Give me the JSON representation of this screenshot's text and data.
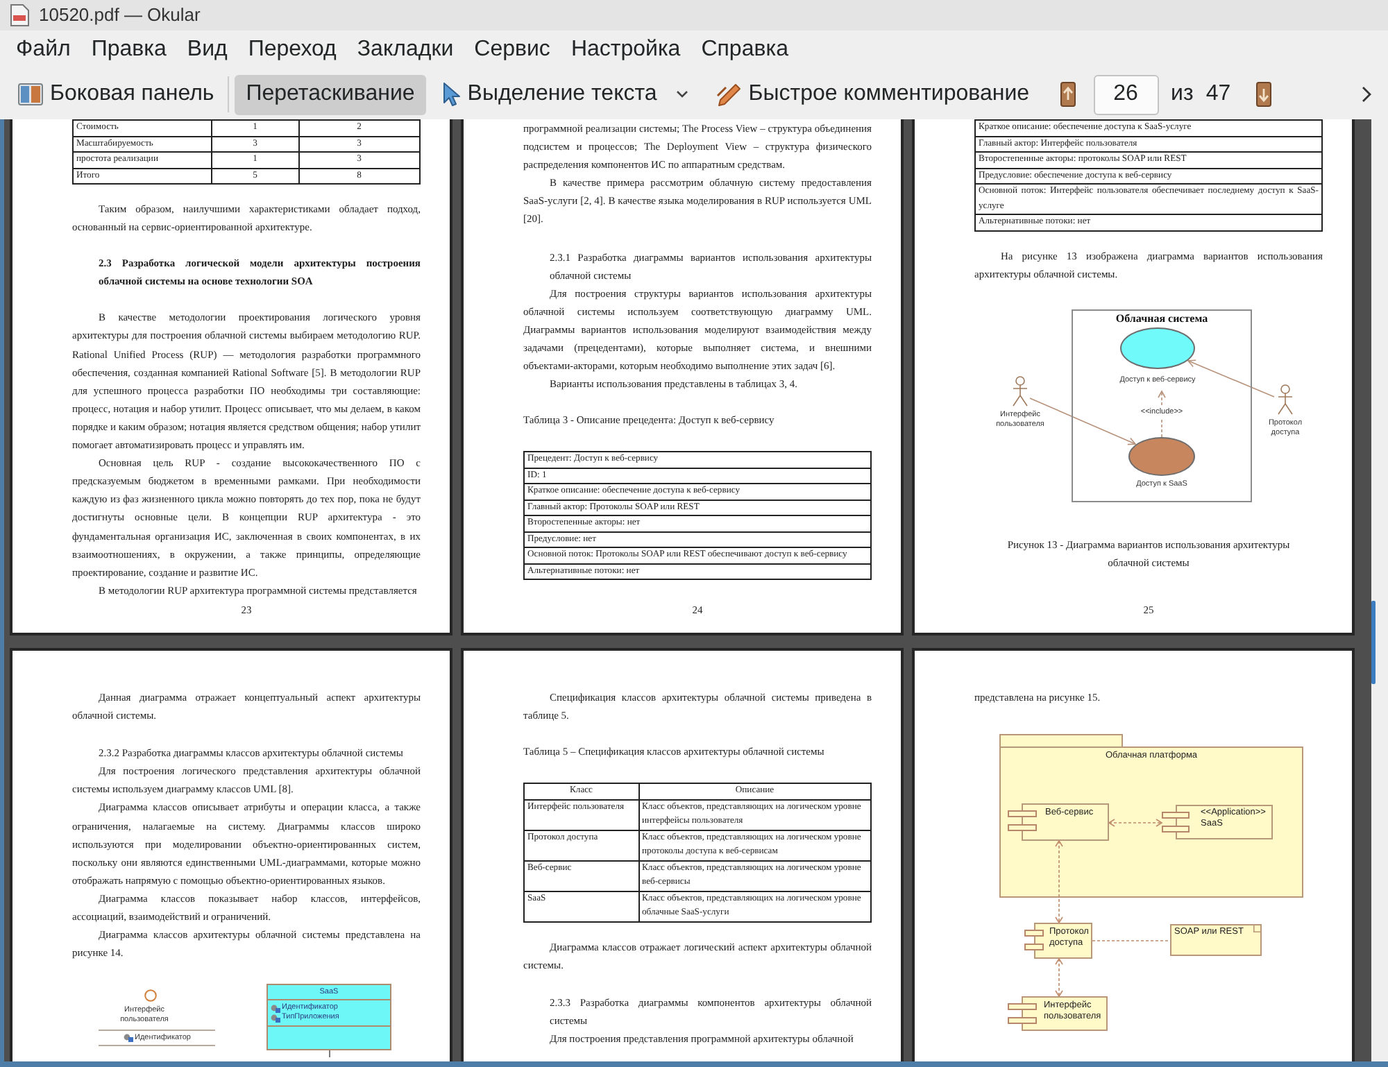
{
  "window": {
    "title": "10520.pdf — Okular"
  },
  "menu": [
    "Файл",
    "Правка",
    "Вид",
    "Переход",
    "Закладки",
    "Сервис",
    "Настройка",
    "Справка"
  ],
  "toolbar": {
    "sidebar_button": {
      "label": "Боковая панель"
    },
    "tools": [
      {
        "kind": "browse",
        "label": "Перетаскивание",
        "selected": true
      },
      {
        "kind": "text_select",
        "label": "Выделение текста",
        "selected": false
      },
      {
        "kind": "annotate",
        "label": "Быстрое комментирование",
        "selected": false
      }
    ],
    "page_field": {
      "value": "26"
    },
    "page_label": "из",
    "page_count": "47"
  },
  "pages": [
    {
      "number": "23",
      "blocks": [
        {
          "kind": "table",
          "rows": [
            [
              "Стоимость",
              "1",
              "2"
            ],
            [
              "Масштабируемость",
              "3",
              "3"
            ],
            [
              "простота реализации",
              "1",
              "3"
            ],
            [
              "Итого",
              "5",
              "8"
            ]
          ]
        },
        {
          "kind": "paragraph",
          "text": "Таким образом, наилучшими характеристиками обладает подход, основанный на сервис-ориентированной архитектуре."
        },
        {
          "kind": "heading",
          "text": "2.3 Разработка логической модели архитектуры построения облачной системы на основе технологии SOA"
        },
        {
          "kind": "paragraph",
          "text": "В качестве методологии проектирования логического уровня архитектуры для построения облачной системы выбираем методологию RUP. Rational Unified Process (RUP) — методология разработки программного обеспечения, созданная компанией Rational Software [5]. В методологии RUP для успешного процесса разработки ПО необходимы три составляющие: процесс, нотация и набор утилит. Процесс описывает, что мы делаем, в каком порядке и каким образом; нотация является средством общения; набор утилит помогает автоматизировать процесс и управлять им."
        },
        {
          "kind": "paragraph",
          "text": "Основная цель RUP - создание высококачественного ПО с предсказуемым бюджетом в временными рамками. При необходимости каждую из фаз жизненного цикла можно повторять до тех пор, пока не будут достигнуты основные цели. В концепции RUP архитектура - это фундаментальная организация ИС, заключенная в своих компонентах, в их взаимоотношениях, в окружении, а также принципы, определяющие проектирование, создание и развитие ИС."
        },
        {
          "kind": "paragraph",
          "text": "В методологии RUP архитектура программной системы представляется"
        }
      ]
    },
    {
      "number": "24",
      "blocks": [
        {
          "kind": "continuation",
          "text": "программной реализации системы; The Process View – структура объединения подсистем и процессов; The Deployment View – структура физического распределения компонентов ИС по аппаратным средствам."
        },
        {
          "kind": "paragraph",
          "text": "В качестве примера рассмотрим облачную систему предоставления SaaS-услуги [2, 4]. В качестве языка моделирования в RUP используется UML [20]."
        },
        {
          "kind": "subheading",
          "text": "2.3.1 Разработка диаграммы вариантов использования архитектуры облачной системы"
        },
        {
          "kind": "paragraph",
          "text": "Для построения структуры вариантов использования архитектуры облачной системы используем соответствующую диаграмму UML. Диаграммы вариантов использования моделируют взаимодействия между задачами (прецедентами), которые выполняет система, и внешними объектами-акторами, которым необходимо выполнение этих задач [6]."
        },
        {
          "kind": "paragraph",
          "text": "Варианты использования представлены в таблицах 3, 4."
        },
        {
          "kind": "table_title",
          "text": "Таблица 3 - Описание прецедента: Доступ к веб-сервису"
        },
        {
          "kind": "table",
          "rows": [
            [
              "Прецедент: Доступ к веб-сервису"
            ],
            [
              "ID: 1"
            ],
            [
              "Краткое описание: обеспечение доступа к веб-сервису"
            ],
            [
              "Главный актор: Протоколы SOAP или REST"
            ],
            [
              "Второстепенные акторы: нет"
            ],
            [
              "Предусловие: нет"
            ],
            [
              "Основной поток: Протоколы SOAP или REST обеспечивают доступ к веб-сервису"
            ],
            [
              "Альтернативные потоки: нет"
            ]
          ]
        }
      ]
    },
    {
      "number": "25",
      "blocks": [
        {
          "kind": "table",
          "rows": [
            [
              "Краткое описание: обеспечение доступа к SaaS-услуге"
            ],
            [
              "Главный актор: Интерфейс пользователя"
            ],
            [
              "Второстепенные акторы: протоколы SOAP или REST"
            ],
            [
              "Предусловие: обеспечение доступа к веб-сервису"
            ],
            [
              "Основной поток: Интерфейс пользователя обеспечивает последнему доступ к SaaS-услуге"
            ],
            [
              "Альтернативные потоки: нет"
            ]
          ]
        },
        {
          "kind": "paragraph",
          "text": "На рисунке 13 изображена диаграмма вариантов использования архитектуры облачной системы."
        },
        {
          "kind": "use_case_diagram",
          "title": "Облачная система",
          "use_cases": [
            {
              "label": "Доступ к веб-сервису",
              "color": "#70fafa"
            },
            {
              "label": "Доступ к SaaS",
              "color": "#c8865e"
            }
          ],
          "relation": "<<include>>",
          "actors": [
            {
              "label": "Интерфейс пользователя"
            },
            {
              "label": "Протокол доступа"
            }
          ]
        },
        {
          "kind": "caption",
          "text": "Рисунок 13 - Диаграмма вариантов использования архитектуры облачной системы"
        }
      ]
    },
    {
      "blocks": [
        {
          "kind": "paragraph",
          "text": "Данная диаграмма отражает концептуальный аспект архитектуры облачной системы."
        },
        {
          "kind": "subheading",
          "text": "2.3.2 Разработка диаграммы классов архитектуры облачной системы"
        },
        {
          "kind": "paragraph",
          "text": "Для построения логического представления архитектуры облачной системы используем диаграмму классов UML [8]."
        },
        {
          "kind": "paragraph",
          "text": "Диаграмма классов описывает атрибуты и операции класса, а также ограничения, налагаемые на систему. Диаграммы классов широко используются при моделировании объектно-ориентированных систем, поскольку они являются единственными UML-диаграммами, которые можно отображать напрямую с помощью объектно-ориентированных языков."
        },
        {
          "kind": "paragraph",
          "text": "Диаграмма классов показывает набор классов, интерфейсов, ассоциаций, взаимодействий и ограничений."
        },
        {
          "kind": "paragraph",
          "text": "Диаграмма классов архитектуры облачной системы представлена на рисунке 14."
        },
        {
          "kind": "class_diagram",
          "classes": [
            {
              "kind": "interface",
              "name": "Интерфейс пользователя",
              "attributes": [
                "Идентификатор"
              ]
            },
            {
              "kind": "class",
              "name": "SaaS",
              "attributes": [
                "Идентификатор",
                "ТипПриложения"
              ]
            }
          ]
        }
      ]
    },
    {
      "blocks": [
        {
          "kind": "paragraph",
          "text": "Спецификация классов архитектуры облачной системы приведена в таблице 5."
        },
        {
          "kind": "table_title",
          "text": "Таблица 5 – Спецификация классов архитектуры облачной системы"
        },
        {
          "kind": "table",
          "header": [
            "Класс",
            "Описание"
          ],
          "rows": [
            [
              "Интерфейс пользователя",
              "Класс объектов, представляющих на логическом уровне интерфейсы пользователя"
            ],
            [
              "Протокол доступа",
              "Класс объектов, представляющих на логическом уровне протоколы доступа к веб-сервисам"
            ],
            [
              "Веб-сервис",
              "Класс объектов, представляющих на логическом уровне веб-сервисы"
            ],
            [
              "SaaS",
              "Класс объектов, представляющих на логическом уровне облачные SaaS-услуги"
            ]
          ]
        },
        {
          "kind": "paragraph",
          "text": "Диаграмма классов отражает логический аспект архитектуры облачной системы."
        },
        {
          "kind": "subheading",
          "text": "2.3.3 Разработка диаграммы компонентов архитектуры облачной системы"
        },
        {
          "kind": "paragraph",
          "text": "Для построения представления программной архитектуры облачной"
        }
      ]
    },
    {
      "blocks": [
        {
          "kind": "continuation",
          "text": "представлена на рисунке 15."
        },
        {
          "kind": "component_diagram",
          "package": "Облачная платформа",
          "components": [
            {
              "name": "Веб-сервис"
            },
            {
              "stereotype": "<<Application>>",
              "name": "SaaS"
            },
            {
              "name": "Протокол доступа"
            },
            {
              "name": "Интерфейс пользователя"
            }
          ],
          "note": "SOAP или REST"
        }
      ]
    }
  ]
}
